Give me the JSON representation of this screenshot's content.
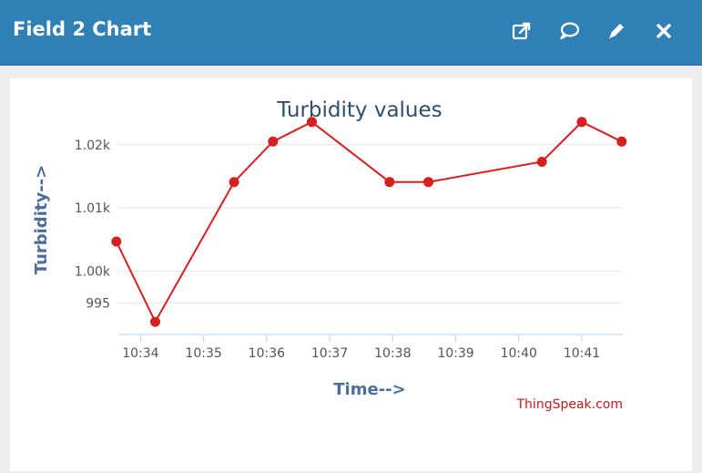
{
  "header": {
    "title": "Field 2 Chart",
    "icons": [
      "external-link-icon",
      "comment-icon",
      "pencil-icon",
      "close-icon"
    ]
  },
  "colors": {
    "header_bg": "#2f80b6",
    "series": "#d62020",
    "axis_text": "#555555",
    "axis_title": "#4a6d9a",
    "title": "#2f4d6e",
    "credit": "#c41a1a"
  },
  "chart_data": {
    "type": "line",
    "title": "Turbidity values",
    "xlabel": "Time-->",
    "ylabel": "Turbidity-->",
    "credit": "ThingSpeak.com",
    "x_tick_labels": [
      "10:34",
      "10:35",
      "10:36",
      "10:37",
      "10:38",
      "10:39",
      "10:40",
      "10:41"
    ],
    "y_tick_labels": [
      "995",
      "1.00k",
      "1.01k",
      "1.02k"
    ],
    "y_ticks": [
      995,
      1000,
      1010,
      1020
    ],
    "ylim": [
      990,
      1024
    ],
    "xlim": [
      "10:33:38",
      "10:41:39"
    ],
    "grid": true,
    "series": [
      {
        "x": [
          "10:33:37",
          "10:34:14",
          "10:35:29",
          "10:36:06",
          "10:36:43",
          "10:37:57",
          "10:38:34",
          "10:40:22",
          "10:41:00",
          "10:41:38"
        ],
        "y": [
          1004.7,
          992.0,
          1014.1,
          1020.5,
          1023.6,
          1014.1,
          1014.1,
          1017.3,
          1023.6,
          1020.5
        ]
      }
    ]
  }
}
